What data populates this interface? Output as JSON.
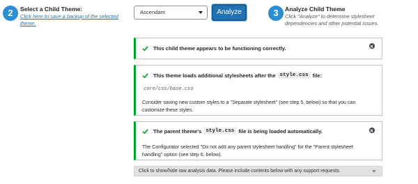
{
  "step2": {
    "number": "2",
    "title": "Select a Child Theme:",
    "link": "Click here to save a backup of the selected theme."
  },
  "theme_select": {
    "value": "Ascendant"
  },
  "analyze_button": {
    "label": "Analyze"
  },
  "step3": {
    "number": "3",
    "title": "Analyze Child Theme",
    "description": "Click \"Analyze\" to determine stylesheet dependencies and other potential issues."
  },
  "notices": [
    {
      "heading": "This child theme appears to be functioning correctly."
    },
    {
      "heading_before": "This theme loads additional stylesheets after the",
      "code": "style.css",
      "heading_after": "file:",
      "path": "core/css/base.css",
      "body": "Consider saving new custom styles to a \"Separate stylesheet\" (see step 5, below) so that you can customize these styles."
    },
    {
      "heading_before": "The parent theme's",
      "code": "style.css",
      "heading_after": "file is being loaded automatically.",
      "body": "The Configurator selected \"Do not add any parent stylesheet handling\" for the \"Parent stylesheet handling\" option (see step 6, below)."
    }
  ],
  "raw_data_toggle": {
    "label": "Click to show/hide raw analysis data. Please include contents below with any support requests."
  },
  "colors": {
    "accent": "#2a8ed1",
    "button": "#2271b1",
    "success": "#00a32a"
  }
}
